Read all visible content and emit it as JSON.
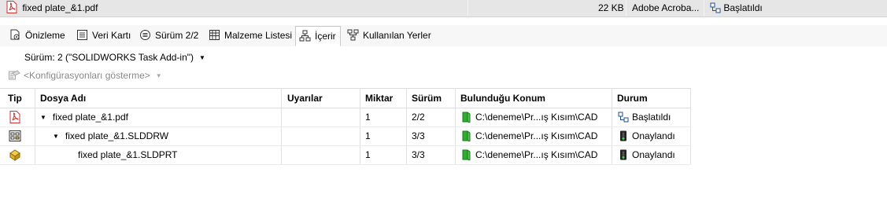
{
  "file_row": {
    "name": "fixed plate_&1.pdf",
    "size": "22 KB",
    "app": "Adobe Acroba...",
    "state": "Başlatıldı"
  },
  "tabs": [
    {
      "label": "Önizleme",
      "icon": "preview-icon"
    },
    {
      "label": "Veri Kartı",
      "icon": "data-card-icon"
    },
    {
      "label": "Sürüm 2/2",
      "icon": "version-icon"
    },
    {
      "label": "Malzeme Listesi",
      "icon": "bom-icon"
    },
    {
      "label": "İçerir",
      "icon": "contains-icon",
      "active": true
    },
    {
      "label": "Kullanılan Yerler",
      "icon": "where-used-icon"
    }
  ],
  "version_select": {
    "label": "Sürüm: 2 (\"SOLIDWORKS Task Add-in\")"
  },
  "config": {
    "label": "<Konfigürasyonları gösterme>"
  },
  "table": {
    "headers": {
      "tip": "Tip",
      "name": "Dosya Adı",
      "warnings": "Uyarılar",
      "qty": "Miktar",
      "version": "Sürüm",
      "location": "Bulunduğu Konum",
      "status": "Durum"
    },
    "rows": [
      {
        "icon": "pdf-file-icon",
        "name": "fixed plate_&1.pdf",
        "warnings": "",
        "qty": "1",
        "version": "2/2",
        "location": "C:\\deneme\\Pr...ış Kısım\\CAD",
        "status": "Başlatıldı",
        "status_icon": "workflow-started-icon"
      },
      {
        "icon": "drawing-file-icon",
        "name": "fixed plate_&1.SLDDRW",
        "warnings": "",
        "qty": "1",
        "version": "3/3",
        "location": "C:\\deneme\\Pr...ış Kısım\\CAD",
        "status": "Onaylandı",
        "status_icon": "approved-icon"
      },
      {
        "icon": "part-file-icon",
        "name": "fixed plate_&1.SLDPRT",
        "warnings": "",
        "qty": "1",
        "version": "3/3",
        "location": "C:\\deneme\\Pr...ış Kısım\\CAD",
        "status": "Onaylandı",
        "status_icon": "approved-icon"
      }
    ]
  },
  "colors": {
    "folder_green": "#2fae2f",
    "pdf_red": "#d0342c",
    "part_yellow": "#e5b31f",
    "tab_active_border": "#c9c9c9"
  }
}
